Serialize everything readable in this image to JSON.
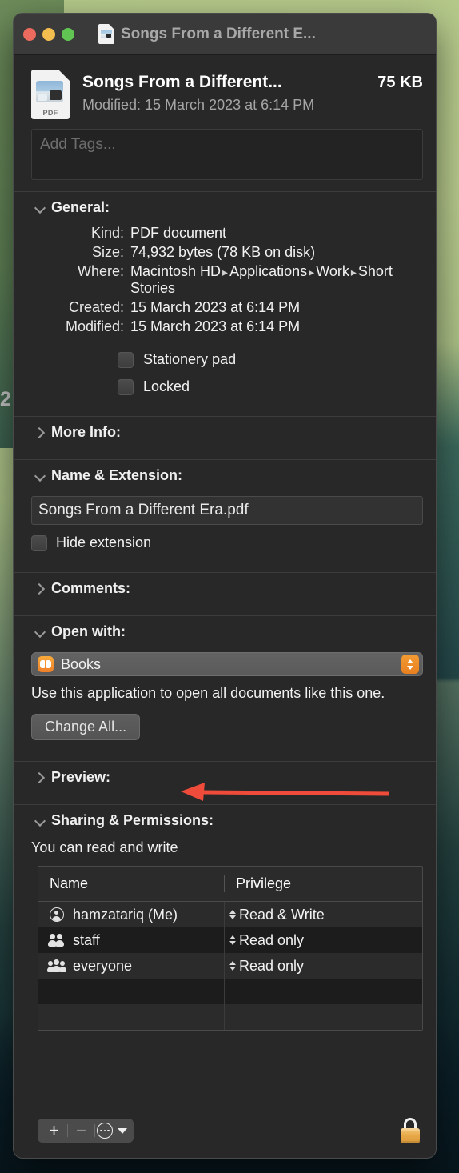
{
  "desktop": {
    "stray_digit": "2"
  },
  "window": {
    "title": "Songs From a Different E...",
    "title_icon": "pdf-document-icon",
    "controls": {
      "close": "close-button",
      "minimize": "minimize-button",
      "zoom": "zoom-button"
    }
  },
  "header": {
    "icon_label": "PDF",
    "file_name": "Songs From a Different...",
    "file_size": "75 KB",
    "modified": "Modified: 15 March 2023 at 6:14 PM"
  },
  "tags": {
    "placeholder": "Add Tags..."
  },
  "sections": {
    "general": {
      "label": "General:",
      "expanded": true,
      "rows": [
        {
          "key": "Kind:",
          "value": "PDF document"
        },
        {
          "key": "Size:",
          "value": "74,932 bytes (78 KB on disk)"
        },
        {
          "key": "Created:",
          "value": "15 March 2023 at 6:14 PM"
        },
        {
          "key": "Modified:",
          "value": "15 March 2023 at 6:14 PM"
        }
      ],
      "where_key": "Where:",
      "where_parts": [
        "Macintosh HD",
        "Applications",
        "Work",
        "Short Stories"
      ],
      "checkboxes": [
        {
          "label": "Stationery pad",
          "checked": false
        },
        {
          "label": "Locked",
          "checked": false
        }
      ]
    },
    "more_info": {
      "label": "More Info:",
      "expanded": false
    },
    "name_extension": {
      "label": "Name & Extension:",
      "expanded": true,
      "name_value": "Songs From a Different Era.pdf",
      "hide_extension_label": "Hide extension",
      "hide_extension_checked": false
    },
    "comments": {
      "label": "Comments:",
      "expanded": false
    },
    "open_with": {
      "label": "Open with:",
      "expanded": true,
      "app_name": "Books",
      "app_icon": "books-app-icon",
      "note": "Use this application to open all documents like this one.",
      "change_all_label": "Change All..."
    },
    "preview": {
      "label": "Preview:",
      "expanded": false
    },
    "sharing": {
      "label": "Sharing & Permissions:",
      "expanded": true,
      "access_note": "You can read and write",
      "columns": [
        "Name",
        "Privilege"
      ],
      "rows": [
        {
          "icon": "single-person-icon",
          "name": "hamzatariq (Me)",
          "privilege": "Read & Write"
        },
        {
          "icon": "two-people-icon",
          "name": "staff",
          "privilege": "Read only"
        },
        {
          "icon": "three-people-icon",
          "name": "everyone",
          "privilege": "Read only"
        }
      ],
      "empty_rows": 2
    }
  },
  "bottom_bar": {
    "add_label": "+",
    "remove_label": "−",
    "action_menu_icon": "ellipsis-circle-icon",
    "action_menu_caret": "chevron-down-icon",
    "lock_icon": "closed-lock-icon"
  },
  "annotation": {
    "arrow_color": "#ee4b3a",
    "points_to": "change-all-button"
  },
  "colors": {
    "window_bg": "#282828",
    "titlebar_bg": "#3a3a3a",
    "accent_orange": "#ef8020",
    "close_red": "#ed6a5e",
    "minimize_yellow": "#f4bd4f",
    "zoom_green": "#61c554",
    "text_primary": "#f2f2f2",
    "text_secondary": "#a5a5a5"
  }
}
